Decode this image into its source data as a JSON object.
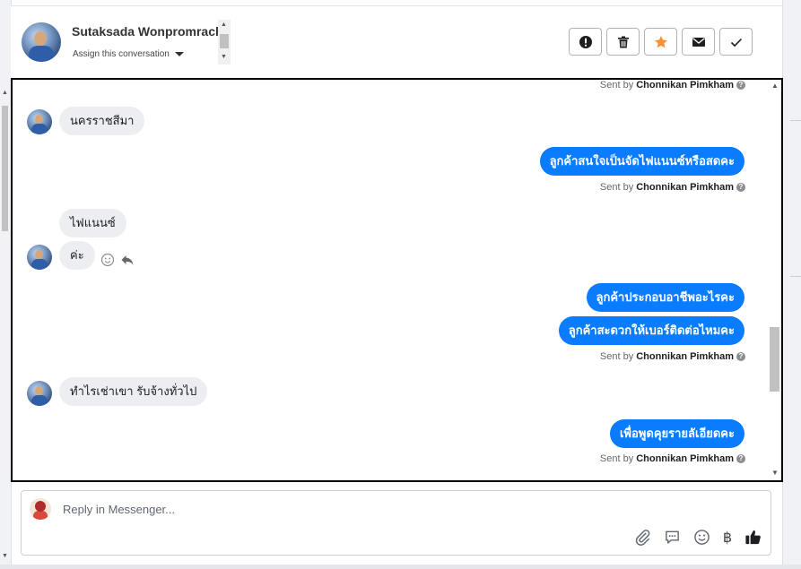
{
  "header": {
    "contact_name": "Sutaksada Wonpromrach",
    "assign_label": "Assign this conversation"
  },
  "actions": [
    {
      "name": "mark-spam",
      "icon": "exclamation-circle-icon"
    },
    {
      "name": "delete",
      "icon": "trash-icon"
    },
    {
      "name": "star",
      "icon": "star-icon"
    },
    {
      "name": "mark-unread",
      "icon": "envelope-icon"
    },
    {
      "name": "mark-done",
      "icon": "check-icon"
    }
  ],
  "conversation": {
    "sent_by_prefix": "Sent by",
    "agent_name": "Chonnikan Pimkham",
    "messages": [
      {
        "direction": "in",
        "text": "นครราชสีมา"
      },
      {
        "direction": "out",
        "text": "ลูกค้าสนใจเป็นจัดไฟแนนซ์หรือสดคะ"
      },
      {
        "direction": "in",
        "text": "ไฟแนนซ์"
      },
      {
        "direction": "in",
        "text": "ค่ะ"
      },
      {
        "direction": "out",
        "text": "ลูกค้าประกอบอาชีพอะไรคะ"
      },
      {
        "direction": "out",
        "text": "ลูกค้าสะดวกให้เบอร์ติดต่อไหมคะ"
      },
      {
        "direction": "in",
        "text": "ทำไรเช่าเขา  รับจ้างทั่วไป"
      },
      {
        "direction": "out",
        "text": "เพื่อพูดคุยรายลัเอียดคะ"
      }
    ]
  },
  "composer": {
    "placeholder": "Reply in Messenger...",
    "baht_symbol": "฿"
  },
  "colors": {
    "outgoing_bubble": "#0a7cff",
    "incoming_bubble": "#eceef1",
    "star_orange": "#f7923a"
  }
}
